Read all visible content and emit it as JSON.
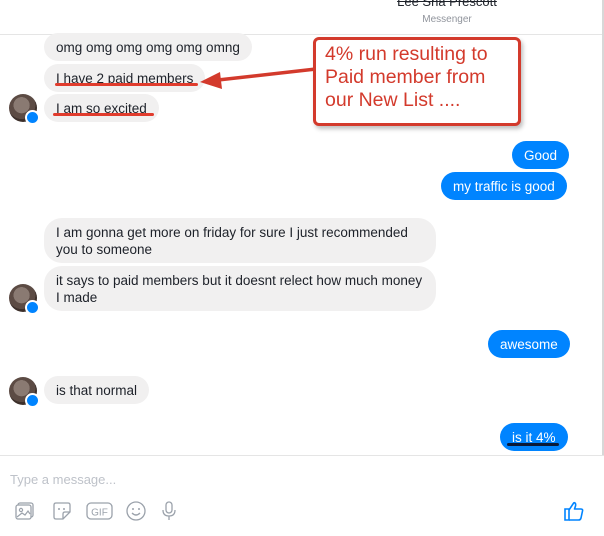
{
  "header": {
    "contact_name": "Lee Sha Prescott",
    "subtitle": "Messenger"
  },
  "messages": [
    {
      "id": "m1",
      "side": "incoming",
      "text": "omg omg omg omg omg omng"
    },
    {
      "id": "m2",
      "side": "incoming",
      "text": "I have 2 paid members"
    },
    {
      "id": "m3",
      "side": "incoming",
      "text": "I am so excited"
    },
    {
      "id": "m4",
      "side": "outgoing",
      "text": "Good"
    },
    {
      "id": "m5",
      "side": "outgoing",
      "text": "my traffic is good"
    },
    {
      "id": "m6",
      "side": "incoming",
      "text": "I am gonna get more on friday for sure I just recommended you to someone"
    },
    {
      "id": "m7",
      "side": "incoming",
      "text": "it says to paid members but it doesnt relect how much money I made"
    },
    {
      "id": "m8",
      "side": "outgoing",
      "text": "awesome"
    },
    {
      "id": "m9",
      "side": "incoming",
      "text": "is that normal"
    },
    {
      "id": "m10",
      "side": "outgoing",
      "text": "is it 4%"
    }
  ],
  "annotation": {
    "text": "4% run resulting to Paid member from our New List ....",
    "color": "#d33a2c"
  },
  "composer": {
    "placeholder": "Type a message...",
    "tools": [
      "photo-icon",
      "sticker-icon",
      "gif-icon",
      "emoji-icon",
      "microphone-icon"
    ],
    "gif_label": "GIF",
    "send_icon": "thumbs-up-icon"
  },
  "colors": {
    "accent": "#0084ff",
    "incoming_bubble": "#f1f0f0",
    "annotation_red": "#d33a2c"
  }
}
